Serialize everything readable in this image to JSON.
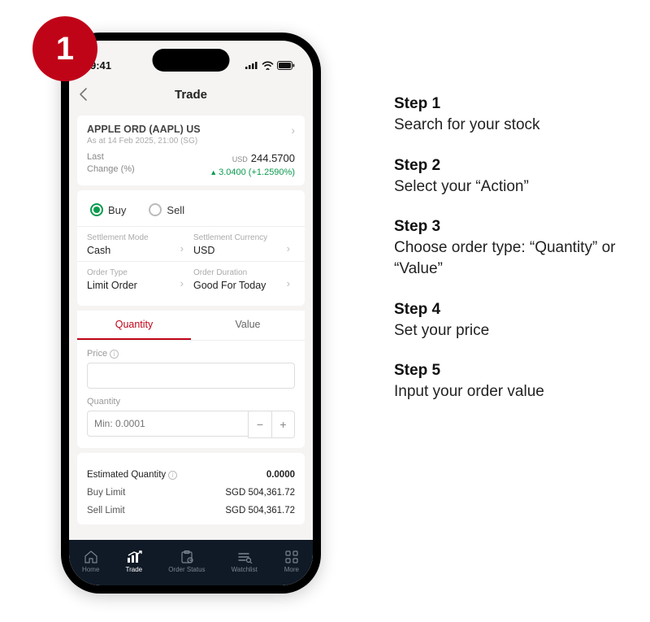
{
  "badge": "1",
  "status": {
    "time": "9:41"
  },
  "header": {
    "title": "Trade"
  },
  "stock": {
    "name": "APPLE ORD (AAPL) US",
    "asof": "As at 14 Feb 2025, 21:00 (SG)",
    "last_label": "Last",
    "change_label": "Change (%)",
    "currency": "USD",
    "price": "244.5700",
    "change": "3.0400 (+1.2590%)"
  },
  "action": {
    "buy": "Buy",
    "sell": "Sell"
  },
  "settlement": {
    "mode_label": "Settlement Mode",
    "mode_value": "Cash",
    "currency_label": "Settlement Currency",
    "currency_value": "USD",
    "order_type_label": "Order Type",
    "order_type_value": "Limit Order",
    "duration_label": "Order Duration",
    "duration_value": "Good For Today"
  },
  "tabs": {
    "quantity": "Quantity",
    "value": "Value"
  },
  "form": {
    "price_label": "Price",
    "quantity_label": "Quantity",
    "quantity_placeholder": "Min: 0.0001"
  },
  "summary": {
    "est_qty_label": "Estimated Quantity",
    "est_qty_value": "0.0000",
    "buy_limit_label": "Buy Limit",
    "buy_limit_value": "SGD 504,361.72",
    "sell_limit_label": "Sell Limit",
    "sell_limit_value": "SGD 504,361.72"
  },
  "tabbar": {
    "home": "Home",
    "trade": "Trade",
    "order_status": "Order Status",
    "watchlist": "Watchlist",
    "more": "More"
  },
  "steps": [
    {
      "title": "Step 1",
      "text": "Search for your stock"
    },
    {
      "title": "Step 2",
      "text": "Select your “Action”"
    },
    {
      "title": "Step 3",
      "text": "Choose order type: “Quantity” or “Value”"
    },
    {
      "title": "Step 4",
      "text": "Set your price"
    },
    {
      "title": "Step 5",
      "text": "Input your order value"
    }
  ]
}
